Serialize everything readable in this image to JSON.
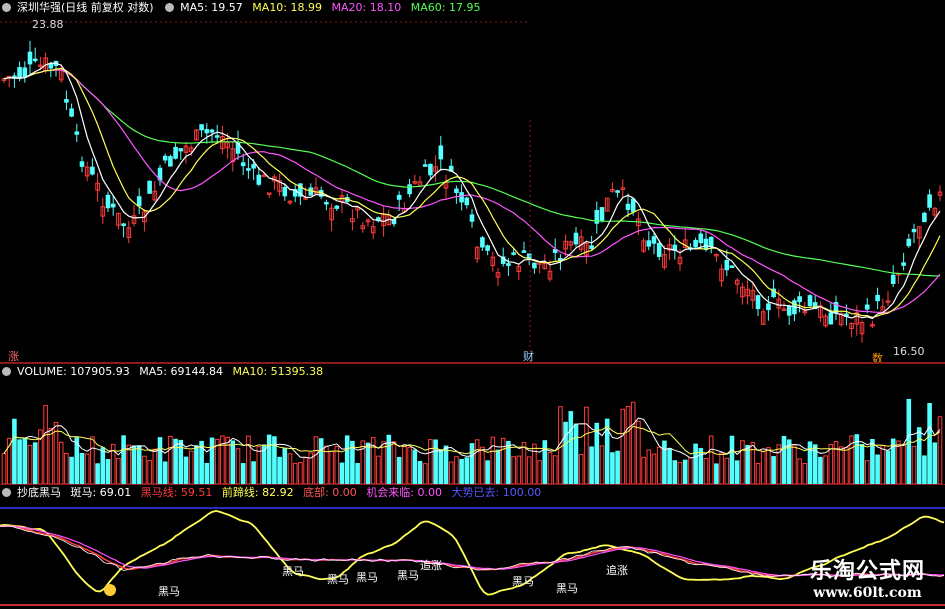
{
  "price": {
    "legend": {
      "name": "深圳华强(日线 前复权 对数)",
      "ma5": "MA5: 19.57",
      "ma10": "MA10: 18.99",
      "ma20": "MA20: 18.10",
      "ma60": "MA60: 17.95"
    },
    "high_label": "23.88",
    "low_label": "16.50",
    "marker_zhang": "涨",
    "marker_cai": "财",
    "marker_shu": "数"
  },
  "volume": {
    "legend": {
      "volume": "VOLUME: 107905.93",
      "ma5": "MA5: 69144.84",
      "ma10": "MA10: 51395.38"
    }
  },
  "indicator": {
    "legend": {
      "name": "抄底黑马",
      "banma": "斑马: 69.01",
      "heima": "黑马线: 59.51",
      "qianti": "前蹄线: 82.92",
      "didi": "底部: 0.00",
      "jihui": "机会来临: 0.00",
      "dashi": "大势已去: 100.00"
    },
    "labels": [
      "黑马",
      "黑马",
      "黑马",
      "黑马",
      "黑马",
      "追涨",
      "黑马",
      "黑马",
      "追涨"
    ]
  },
  "watermark": {
    "title": "乐淘公式网",
    "url": "www.60lt.com"
  },
  "colors": {
    "up": "#ff3c3c",
    "down": "#54ffff",
    "ma5": "#ffffff",
    "ma10": "#ffff55",
    "ma20": "#ff55ff",
    "ma60": "#55ff55"
  }
}
